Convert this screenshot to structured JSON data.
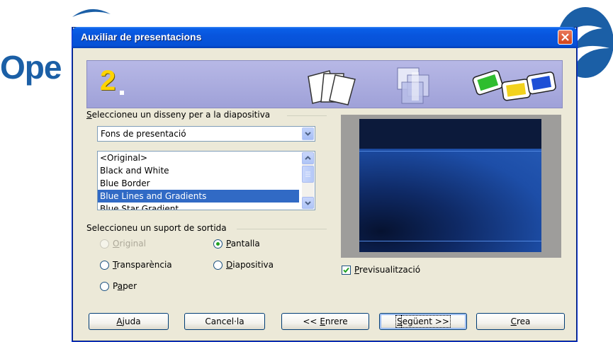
{
  "background": {
    "app_logo_text": "Ope"
  },
  "window": {
    "title": "Auxiliar de presentacions"
  },
  "banner": {
    "step": "2",
    "icons": [
      "blank-pages-icon",
      "overlapping-slides-icon",
      "color-slides-icon"
    ]
  },
  "design": {
    "group_label_prefix": "S",
    "group_label_rest": "eleccioneu un disseny per a la diapositiva",
    "combo_value": "Fons de presentació",
    "list_items": [
      "<Original>",
      "Black and White",
      "Blue Border",
      "Blue Lines and Gradients",
      "Blue Star Gradient"
    ],
    "selected_index": 3
  },
  "output": {
    "group_label": "Seleccioneu un suport de sortida",
    "options": [
      {
        "key": "original",
        "mnemonic": "O",
        "rest": "riginal",
        "checked": false,
        "disabled": true
      },
      {
        "key": "pantalla",
        "mnemonic": "P",
        "rest": "antalla",
        "checked": true,
        "disabled": false
      },
      {
        "key": "transparencia",
        "mnemonic": "T",
        "rest": "ransparència",
        "checked": false,
        "disabled": false
      },
      {
        "key": "diapositiva",
        "mnemonic": "D",
        "rest": "iapositiva",
        "checked": false,
        "disabled": false
      },
      {
        "key": "paper",
        "prefix": "P",
        "mnemonic": "a",
        "rest": "per",
        "checked": false,
        "disabled": false
      }
    ]
  },
  "preview": {
    "checkbox_mnemonic": "P",
    "checkbox_rest": "revisualització",
    "checked": true
  },
  "buttons": {
    "help": {
      "mnemonic": "A",
      "rest": "juda"
    },
    "cancel": "Cancel·la",
    "back": {
      "prefix": "<< ",
      "mnemonic": "E",
      "rest": "nrere"
    },
    "next": {
      "mnemonic": "S",
      "rest": "egüent >>"
    },
    "create": {
      "mnemonic": "C",
      "rest": "rea"
    }
  },
  "colors": {
    "titlebar": "#0855dd",
    "dialog_bg": "#ece9d8",
    "selection": "#316ac5",
    "step_number": "#ffd400",
    "banner": "#a8aade"
  }
}
